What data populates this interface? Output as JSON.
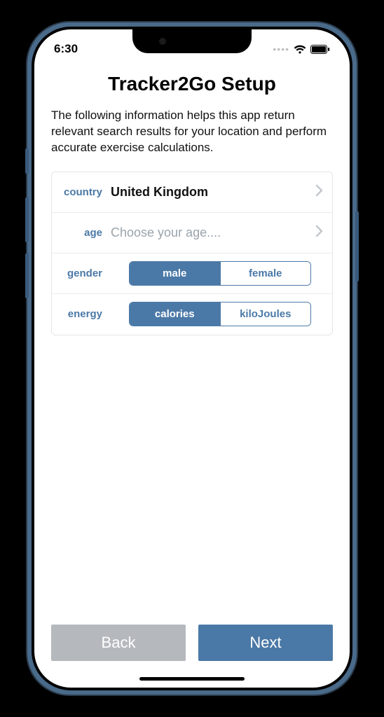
{
  "status": {
    "time": "6:30"
  },
  "header": {
    "title": "Tracker2Go Setup"
  },
  "description": "The following information helps this app return relevant search results for your location and perform accurate exercise calculations.",
  "form": {
    "country": {
      "label": "country",
      "value": "United Kingdom"
    },
    "age": {
      "label": "age",
      "placeholder": "Choose your age...."
    },
    "gender": {
      "label": "gender",
      "options": {
        "male": "male",
        "female": "female"
      },
      "selected": "male"
    },
    "energy": {
      "label": "energy",
      "options": {
        "calories": "calories",
        "kiloJoules": "kiloJoules"
      },
      "selected": "calories"
    }
  },
  "footer": {
    "back": "Back",
    "next": "Next"
  },
  "colors": {
    "accent": "#4b79a7",
    "disabled": "#b5b9bd"
  }
}
